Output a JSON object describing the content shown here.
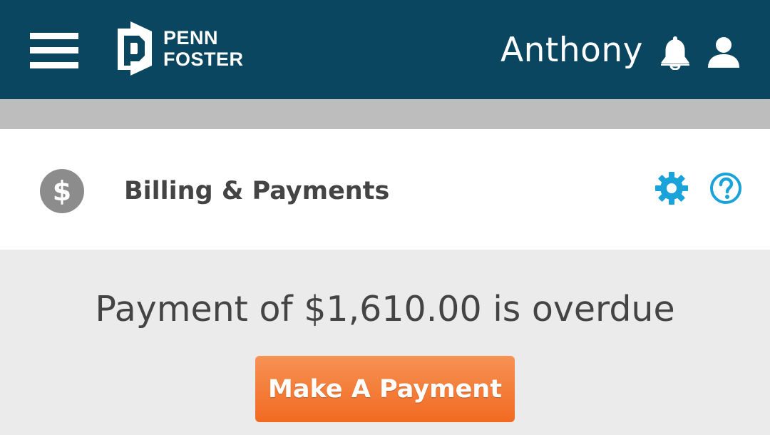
{
  "colors": {
    "header_bg": "#0b4660",
    "accent_blue": "#1aa3d9",
    "button_orange": "#f26a21",
    "badge_gray": "#8c8c8c"
  },
  "header": {
    "menu_icon": "hamburger-menu-icon",
    "logo": {
      "line1": "PENN",
      "line2": "FOSTER"
    },
    "username": "Anthony",
    "notification_icon": "bell-icon",
    "profile_icon": "user-icon"
  },
  "section": {
    "icon": "dollar-icon",
    "icon_glyph": "$",
    "title": "Billing & Payments",
    "settings_icon": "gear-icon",
    "help_icon": "help-icon"
  },
  "main": {
    "overdue_message": "Payment of $1,610.00 is overdue",
    "pay_button_label": "Make A Payment"
  }
}
